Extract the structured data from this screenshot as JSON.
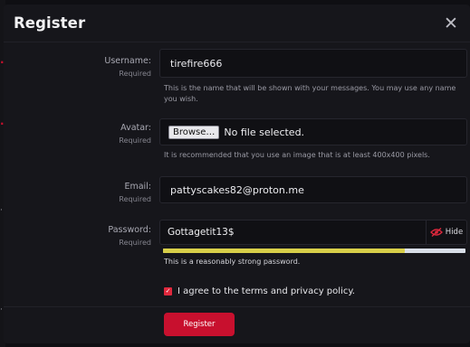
{
  "modal": {
    "title": "Register",
    "close_glyph": "✕"
  },
  "username": {
    "label": "Username:",
    "required": "Required",
    "value": "tirefire666",
    "hint": "This is the name that will be shown with your messages. You may use any name you wish."
  },
  "avatar": {
    "label": "Avatar:",
    "required": "Required",
    "browse_label": "Browse…",
    "file_status": "No file selected.",
    "hint": "It is recommended that you use an image that is at least 400x400 pixels."
  },
  "email": {
    "label": "Email:",
    "required": "Required",
    "value": "pattyscakes82@proton.me"
  },
  "password": {
    "label": "Password:",
    "required": "Required",
    "value": "Gottagetit13$",
    "hide_label": "Hide",
    "hide_icon": "eye-slash-icon",
    "strength_fraction": 0.8,
    "strength_text": "This is a reasonably strong password."
  },
  "terms": {
    "checked": true,
    "label": "I agree to the terms and privacy policy."
  },
  "submit": {
    "label": "Register"
  },
  "colors": {
    "accent": "#c8102e",
    "strength_fill": "#d8cf49",
    "modal_bg": "#16161b"
  }
}
